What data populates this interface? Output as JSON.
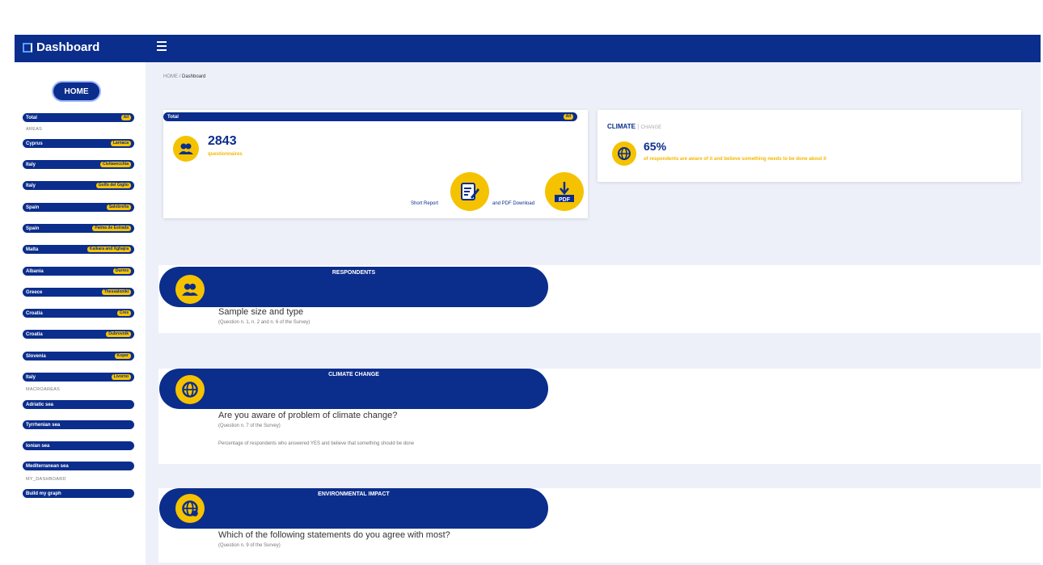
{
  "header": {
    "brand": "Dashboard"
  },
  "sidebar": {
    "home": "HOME",
    "total": {
      "label": "Total",
      "tag": "All"
    },
    "areas_label": "AREAS",
    "areas": [
      {
        "label": "Cyprus",
        "tag": "Larnaca"
      },
      {
        "label": "Italy",
        "tag": "Civitavecchia"
      },
      {
        "label": "Italy",
        "tag": "Golfo del Giglio"
      },
      {
        "label": "Spain",
        "tag": "Salobreña"
      },
      {
        "label": "Spain",
        "tag": "Palma de Estrada"
      },
      {
        "label": "Malta",
        "tag": "Kalkara and Xghajra"
      },
      {
        "label": "Albania",
        "tag": "Durres"
      },
      {
        "label": "Greece",
        "tag": "Thessaloniki"
      },
      {
        "label": "Croatia",
        "tag": "Cres"
      },
      {
        "label": "Croatia",
        "tag": "Dubrovnik"
      },
      {
        "label": "Slovenia",
        "tag": "Koper"
      },
      {
        "label": "Italy",
        "tag": "Livorno"
      }
    ],
    "macroareas_label": "MACROAREAS",
    "macroareas": [
      "Adriatic sea",
      "Tyrrhenian sea",
      "Ionian sea",
      "Mediterranean sea"
    ],
    "my_dashboard_label": "MY_DASHBOARD",
    "my_dashboard": [
      "Build my graph"
    ]
  },
  "breadcrumb": {
    "home": "HOME",
    "sep": "/",
    "current": "Dashboard"
  },
  "total_card": {
    "bar_label": "Total",
    "bar_tag": "All",
    "count": "2843",
    "count_label": "questionnaires",
    "short_report": "Short Report",
    "pdf_download": "and PDF Download",
    "pdf_badge": "PDF"
  },
  "climate_card": {
    "title": "CLIMATE",
    "title_sep": "|",
    "title_sub": "CHANGE",
    "percent": "65%",
    "description": "of respondents are aware of it and believe something needs to be done about it"
  },
  "sections": [
    {
      "title": "RESPONDENTS",
      "question": "Sample size and type",
      "sub": "(Question n. 1, n. 2 and n. 6 of the Survey)",
      "note": ""
    },
    {
      "title": "CLIMATE CHANGE",
      "question": "Are you aware of problem of climate change?",
      "sub": "(Question n. 7 of the Survey)",
      "note": "Percentage of respondents who answered YES and believe that something should be done"
    },
    {
      "title": "ENVIRONMENTAL IMPACT",
      "question": "Which of the following statements do you agree with most?",
      "sub": "(Question n. 9 of the Survey)",
      "note": ""
    }
  ],
  "colors": {
    "primary": "#0b2d8c",
    "accent": "#f5c200"
  }
}
